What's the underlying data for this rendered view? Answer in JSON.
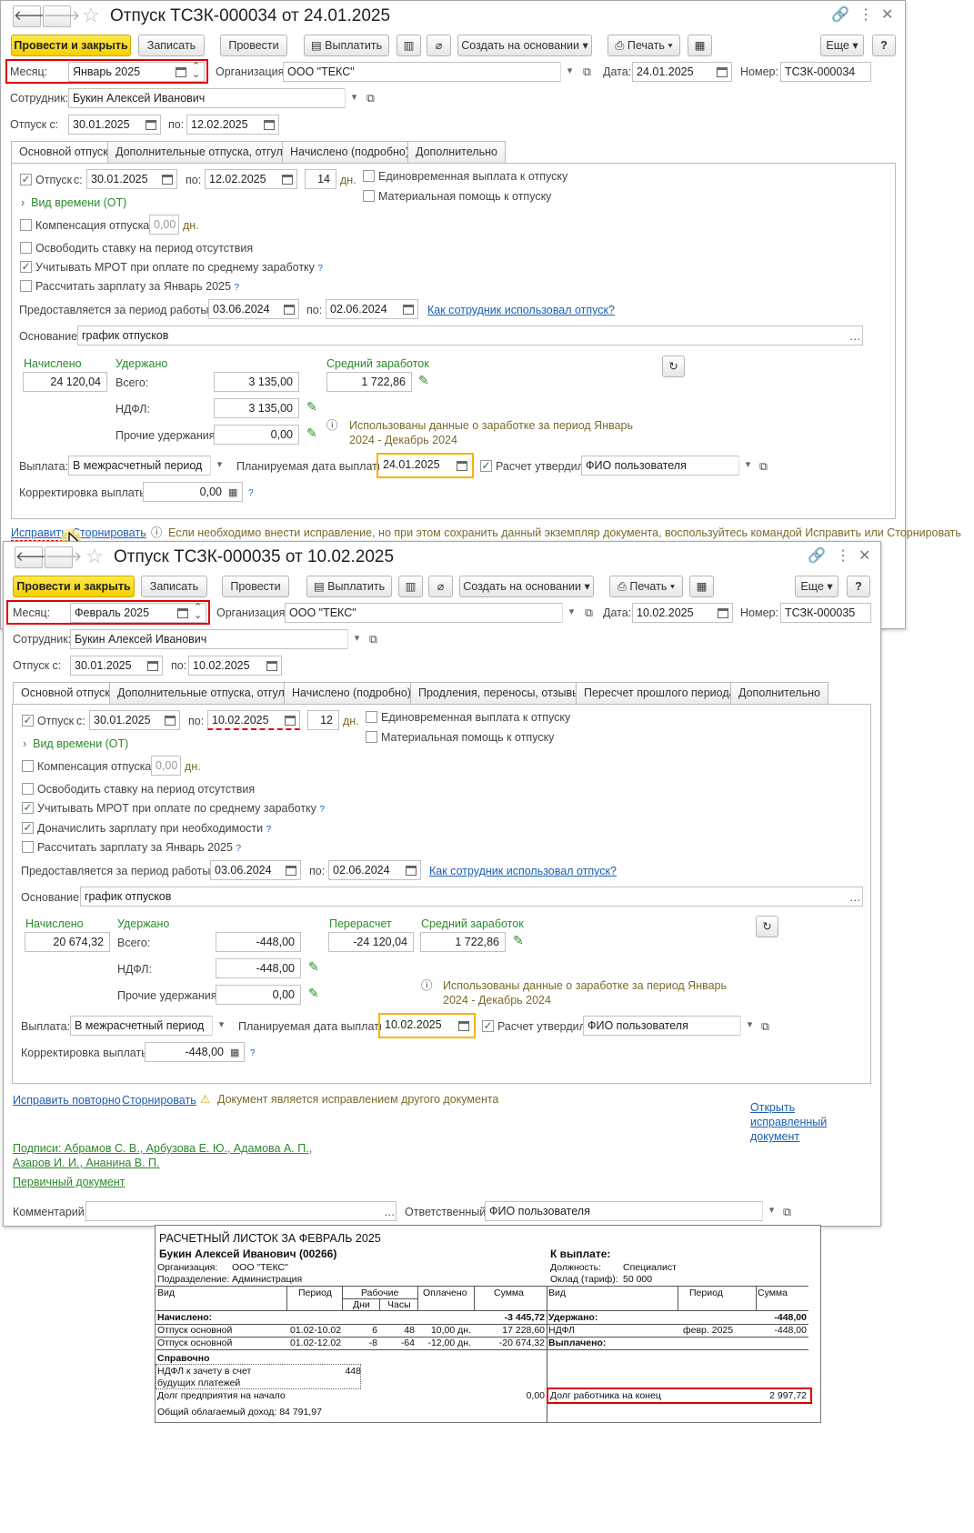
{
  "w1": {
    "title": "Отпуск ТСЗК-000034 от 24.01.2025",
    "toolbar": {
      "post_close": "Провести и закрыть",
      "save": "Записать",
      "post": "Провести",
      "pay": "Выплатить",
      "create_based": "Создать на основании",
      "print": "Печать",
      "more": "Еще",
      "help": "?"
    },
    "month_label": "Месяц:",
    "month": "Январь 2025",
    "org_label": "Организация:",
    "org": "ООО \"ТЕКС\"",
    "date_label": "Дата:",
    "date": "24.01.2025",
    "num_label": "Номер:",
    "num": "ТСЗК-000034",
    "emp_label": "Сотрудник:",
    "emp": "Букин Алексей Иванович",
    "from_label": "Отпуск с:",
    "from": "30.01.2025",
    "to_label": "по:",
    "to": "12.02.2025",
    "tabs": [
      "Основной отпуск",
      "Дополнительные отпуска, отгулы",
      "Начислено (подробно)",
      "Дополнительно"
    ],
    "vac": {
      "label": "Отпуск",
      "s_label": "с:",
      "s": "30.01.2025",
      "po_label": "по:",
      "po": "12.02.2025",
      "days": "14",
      "dn": "дн."
    },
    "one_time": "Единовременная выплата к отпуску",
    "mat_help": "Материальная помощь к отпуску",
    "time_kind": "Вид времени (ОТ)",
    "comp": "Компенсация отпуска",
    "comp_val": "0,00",
    "comp_dn": "дн.",
    "free_rate": "Освободить ставку на период отсутствия",
    "mrot": "Учитывать МРОТ при оплате по среднему заработку",
    "calc_salary": "Рассчитать зарплату за Январь 2025",
    "period_label": "Предоставляется за период работы с:",
    "period_from": "03.06.2024",
    "period_po_label": "по:",
    "period_to": "02.06.2024",
    "how_used": "Как сотрудник использовал отпуск?",
    "basis_label": "Основание:",
    "basis": "график отпусков",
    "accrued_label": "Начислено",
    "accrued": "24 120,04",
    "withheld_label": "Удержано",
    "total_label": "Всего:",
    "total": "3 135,00",
    "ndfl_label": "НДФЛ:",
    "ndfl": "3 135,00",
    "other_label": "Прочие удержания:",
    "other": "0,00",
    "avg_label": "Средний заработок",
    "avg": "1 722,86",
    "info": "Использованы данные о заработке за период Январь 2024 - Декабрь 2024",
    "pay_label": "Выплата:",
    "pay": "В межрасчетный период",
    "plan_label": "Планируемая дата выплаты:",
    "plan": "24.01.2025",
    "approved": "Расчет утвердил",
    "user": "ФИО пользователя",
    "corr_label": "Корректировка выплаты:",
    "corr": "0,00",
    "fix": "Исправить",
    "storno": "Сторнировать",
    "fix_hint": "Если необходимо внести исправление, но при этом сохранить данный экземпляр документа, воспользуйтесь командой Исправить или Сторнировать"
  },
  "w2": {
    "title": "Отпуск ТСЗК-000035 от 10.02.2025",
    "month": "Февраль 2025",
    "date": "10.02.2025",
    "num": "ТСЗК-000035",
    "from": "30.01.2025",
    "to": "10.02.2025",
    "tabs": [
      "Основной отпуск",
      "Дополнительные отпуска, отгулы",
      "Начислено (подробно)",
      "Продления, переносы, отзывы",
      "Пересчет прошлого периода",
      "Дополнительно"
    ],
    "vac_s": "30.01.2025",
    "vac_po": "10.02.2025",
    "days": "12",
    "extra": "Доначислить зарплату при необходимости",
    "accrued": "20 674,32",
    "recalc_label": "Перерасчет",
    "recalc": "-24 120,04",
    "total": "-448,00",
    "ndfl": "-448,00",
    "other": "0,00",
    "avg": "1 722,86",
    "plan": "10.02.2025",
    "corr": "-448,00",
    "fix_again": "Исправить повторно",
    "storno": "Сторнировать",
    "fix_note": "Документ является исправлением другого документа",
    "open_fixed": "Открыть исправленный документ",
    "signs": "Подписи: Абрамов С. В., Арбузова Е. Ю., Адамова А. П., Азаров И. И., Ананина В. П.",
    "primary": "Первичный документ",
    "comment_label": "Комментарий:",
    "resp_label": "Ответственный:",
    "resp": "ФИО пользователя"
  },
  "slip": {
    "title": "РАСЧЕТНЫЙ ЛИСТОК ЗА ФЕВРАЛЬ 2025",
    "name": "Букин Алексей Иванович (00266)",
    "to_pay": "К выплате:",
    "org_label": "Организация:",
    "org": "ООО \"ТЕКС\"",
    "dept_label": "Подразделение:",
    "dept": "Администрация",
    "pos_label": "Должность:",
    "pos": "Специалист",
    "salary_label": "Оклад (тариф):",
    "salary": "50 000",
    "h": {
      "vid": "Вид",
      "period": "Период",
      "work": "Рабочие",
      "days": "Дни",
      "hours": "Часы",
      "paid": "Оплачено",
      "sum": "Сумма"
    },
    "accr": "Начислено:",
    "accr_sum": "-3 445,72",
    "ded": "Удержано:",
    "ded_sum": "-448,00",
    "paid_out": "Выплачено:",
    "rows": [
      {
        "vid": "Отпуск основной",
        "period": "01.02-10.02",
        "days": "6",
        "hours": "48",
        "paid": "10,00 дн.",
        "sum": "17 228,60"
      },
      {
        "vid": "Отпуск основной",
        "period": "01.02-12.02",
        "days": "-8",
        "hours": "-64",
        "paid": "-12,00 дн.",
        "sum": "-20 674,32"
      }
    ],
    "ndfl": "НДФЛ",
    "ndfl_period": "февр. 2025",
    "ndfl_sum": "-448,00",
    "ref": "Справочно",
    "ndfl_credit": "НДФЛ к зачету в счет будущих платежей",
    "ndfl_credit_val": "448",
    "debt_start": "Долг предприятия на начало",
    "debt_start_val": "0,00",
    "debt_end": "Долг работника на конец",
    "debt_end_val": "2 997,72",
    "taxable": "Общий облагаемый доход: 84 791,97"
  }
}
